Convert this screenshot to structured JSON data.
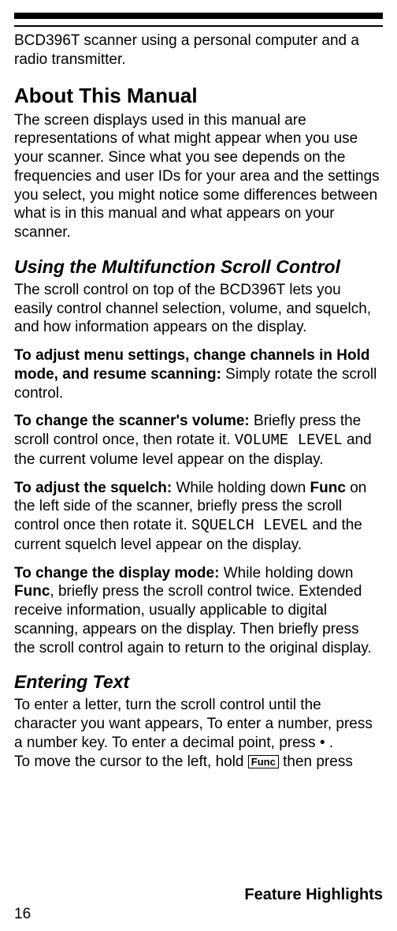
{
  "intro": "BCD396T scanner using a personal computer and a radio transmitter.",
  "h1": "About This Manual",
  "p1": "The screen displays used in this manual are representations of what might appear when you use your scanner. Since what you see depends on the frequencies and user IDs for your area and the settings you select, you might notice some differences between what is in this manual and what appears on your scanner.",
  "h2a": "Using the Multifunction Scroll Control",
  "p2": "The scroll control on top of the BCD396T lets you easily control channel selection, volume, and squelch, and how information appears on the display.",
  "p3_bold": "To adjust menu settings, change channels in Hold mode, and resume scanning: ",
  "p3_rest": "Simply rotate the scroll control.",
  "p4_bold": "To change the scanner's volume: ",
  "p4_a": "Briefly press the scroll control once, then rotate it. ",
  "p4_mono": "VOLUME LEVEL",
  "p4_b": " and the current volume level appear on the display.",
  "p5_bold": "To adjust the squelch: ",
  "p5_a": "While holding down ",
  "p5_func": "Func",
  "p5_b": " on the left side of the scanner, briefly press the scroll control once then rotate it. ",
  "p5_mono": "SQUELCH LEVEL",
  "p5_c": " and the current squelch level appear on the display.",
  "p6_bold": "To change the display mode: ",
  "p6_a": "While holding down ",
  "p6_func": "Func",
  "p6_b": ", briefly press the scroll control twice. Extended receive information, usually applicable to digital scanning, appears on the display. Then briefly press the scroll control again to return to the original display.",
  "h2b": "Entering Text",
  "p7_a": "To enter a letter, turn the scroll control until the character you want appears, To enter a number, press a number key. To enter a decimal point, press ",
  "p7_dot": "•",
  "p7_b": ".",
  "p8_a": "To move the cursor to the left, hold ",
  "p8_func": "Func",
  "p8_b": " then press",
  "footer": "Feature Highlights",
  "page": "16"
}
